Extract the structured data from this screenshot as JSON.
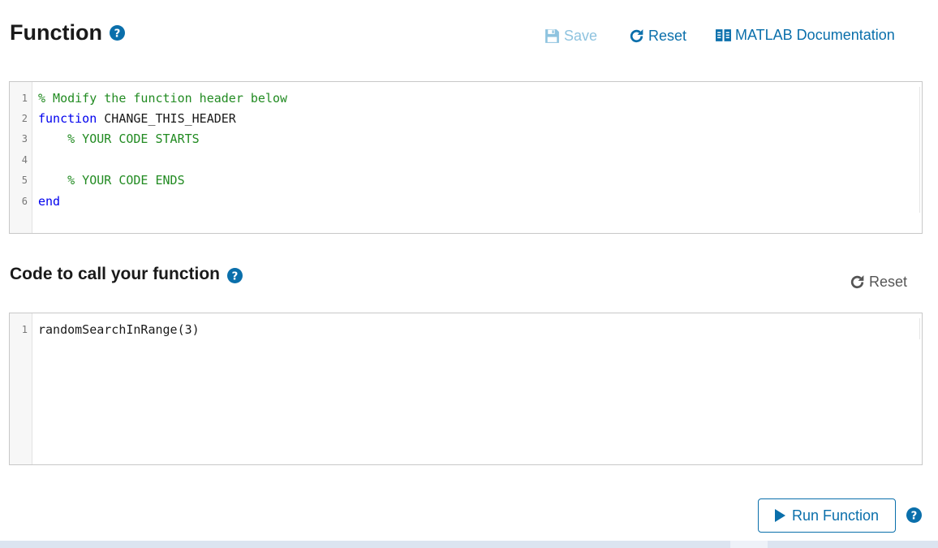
{
  "function_section": {
    "title": "Function",
    "toolbar": {
      "save_label": "Save",
      "reset_label": "Reset",
      "docs_label": "MATLAB Documentation"
    },
    "code_lines": [
      {
        "n": "1",
        "text": "% Modify the function header below",
        "type": "comment"
      },
      {
        "n": "2",
        "kw": "function",
        "rest": " CHANGE_THIS_HEADER"
      },
      {
        "n": "3",
        "text": "    % YOUR CODE STARTS",
        "type": "comment"
      },
      {
        "n": "4",
        "text": "",
        "type": "plain"
      },
      {
        "n": "5",
        "text": "    % YOUR CODE ENDS",
        "type": "comment"
      },
      {
        "n": "6",
        "text": "end",
        "type": "keyword"
      }
    ]
  },
  "call_section": {
    "title": "Code to call your function",
    "reset_label": "Reset",
    "code_lines": [
      {
        "n": "1",
        "text": "randomSearchInRange(3)",
        "type": "plain"
      }
    ]
  },
  "run_button": {
    "label": "Run Function"
  },
  "colors": {
    "accent": "#0a6fab",
    "disabled": "#8ec3df",
    "comment": "#228b22",
    "keyword": "#0000ee"
  }
}
